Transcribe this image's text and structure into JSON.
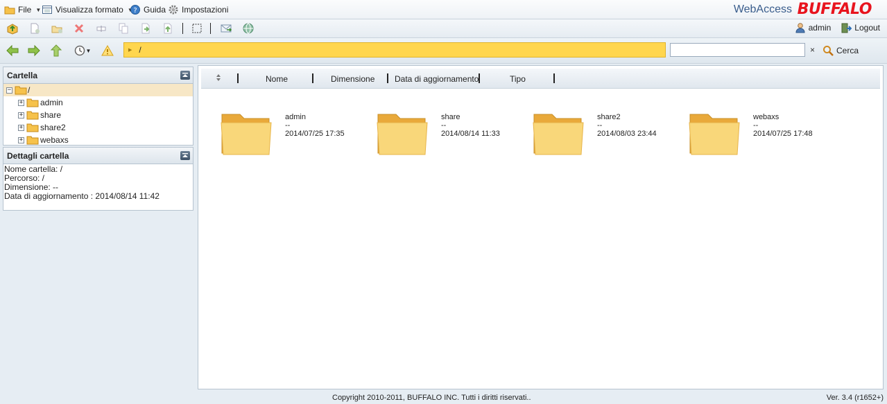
{
  "menu": {
    "file": "File",
    "view": "Visualizza formato",
    "help": "Guida",
    "settings": "Impostazioni"
  },
  "brand": {
    "webaccess": "WebAccess",
    "buffalo": "BUFFALO"
  },
  "user": {
    "name": "admin",
    "logout": "Logout"
  },
  "nav": {
    "path": "/"
  },
  "search": {
    "value": "",
    "clear": "×",
    "button": "Cerca"
  },
  "folder_panel": {
    "title": "Cartella",
    "root": "/",
    "items": [
      {
        "label": "admin"
      },
      {
        "label": "share"
      },
      {
        "label": "share2"
      },
      {
        "label": "webaxs"
      }
    ]
  },
  "details_panel": {
    "title": "Dettagli cartella",
    "lines": [
      "Nome cartella: /",
      "Percorso: /",
      "Dimensione: --",
      "Data di aggiornamento : 2014/08/14 11:42"
    ]
  },
  "columns": {
    "name": "Nome",
    "size": "Dimensione",
    "date": "Data di aggiornamento",
    "type": "Tipo"
  },
  "files": [
    {
      "name": "admin",
      "size": "--",
      "date": "2014/07/25 17:35"
    },
    {
      "name": "share",
      "size": "--",
      "date": "2014/08/14 11:33"
    },
    {
      "name": "share2",
      "size": "--",
      "date": "2014/08/03 23:44"
    },
    {
      "name": "webaxs",
      "size": "--",
      "date": "2014/07/25 17:48"
    }
  ],
  "footer": {
    "copyright": "Copyright 2010-2011, BUFFALO INC. Tutti i diritti riservati..",
    "version": "Ver. 3.4 (r1652+)"
  },
  "colors": {
    "path_bar": "#ffd64e",
    "brand_red": "#e8141e",
    "brand_blue": "#3a5d8c"
  }
}
